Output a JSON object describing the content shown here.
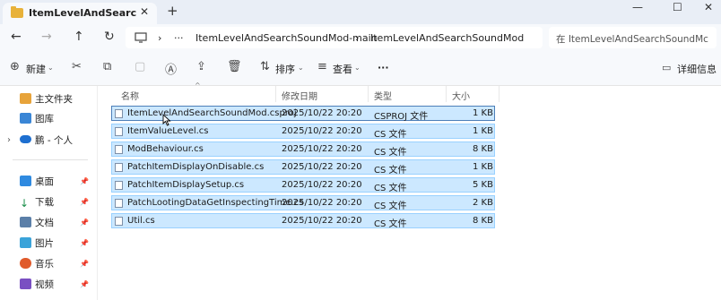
{
  "window": {
    "tab_title": "ItemLevelAndSearchSoundMod",
    "tab_close": "✕",
    "new_tab": "+",
    "minimize": "—",
    "maximize": "☐",
    "close": "✕"
  },
  "address": {
    "back": "←",
    "forward": "→",
    "up": "↑",
    "refresh": "↻",
    "ellipsis": "···",
    "crumbs": [
      "ItemLevelAndSearchSoundMod-main",
      "ItemLevelAndSearchSoundMod"
    ],
    "search_placeholder": "在 ItemLevelAndSearchSoundMc"
  },
  "toolbar": {
    "new_label": "新建",
    "sort_label": "排序",
    "view_label": "查看",
    "more": "···",
    "details_label": "详细信息"
  },
  "sidebar": {
    "top_items": [
      {
        "label": "主文件夹",
        "icon": "home-icon"
      },
      {
        "label": "图库",
        "icon": "gallery-icon"
      },
      {
        "label": "鹏 - 个人",
        "icon": "cloud-icon"
      }
    ],
    "quick_items": [
      {
        "label": "桌面",
        "icon": "desktop-icon"
      },
      {
        "label": "下载",
        "icon": "download-icon"
      },
      {
        "label": "文档",
        "icon": "documents-icon"
      },
      {
        "label": "图片",
        "icon": "pictures-icon"
      },
      {
        "label": "音乐",
        "icon": "music-icon"
      },
      {
        "label": "视频",
        "icon": "videos-icon"
      }
    ]
  },
  "list": {
    "columns": {
      "name": "名称",
      "modified": "修改日期",
      "type": "类型",
      "size": "大小"
    },
    "rows": [
      {
        "name": "ItemLevelAndSearchSoundMod.csproj",
        "modified": "2025/10/22 20:20",
        "type": "CSPROJ 文件",
        "size": "1 KB"
      },
      {
        "name": "ItemValueLevel.cs",
        "modified": "2025/10/22 20:20",
        "type": "CS 文件",
        "size": "1 KB"
      },
      {
        "name": "ModBehaviour.cs",
        "modified": "2025/10/22 20:20",
        "type": "CS 文件",
        "size": "8 KB"
      },
      {
        "name": "PatchItemDisplayOnDisable.cs",
        "modified": "2025/10/22 20:20",
        "type": "CS 文件",
        "size": "1 KB"
      },
      {
        "name": "PatchItemDisplaySetup.cs",
        "modified": "2025/10/22 20:20",
        "type": "CS 文件",
        "size": "5 KB"
      },
      {
        "name": "PatchLootingDataGetInspectingTime.cs",
        "modified": "2025/10/22 20:20",
        "type": "CS 文件",
        "size": "2 KB"
      },
      {
        "name": "Util.cs",
        "modified": "2025/10/22 20:20",
        "type": "CS 文件",
        "size": "8 KB"
      }
    ]
  }
}
